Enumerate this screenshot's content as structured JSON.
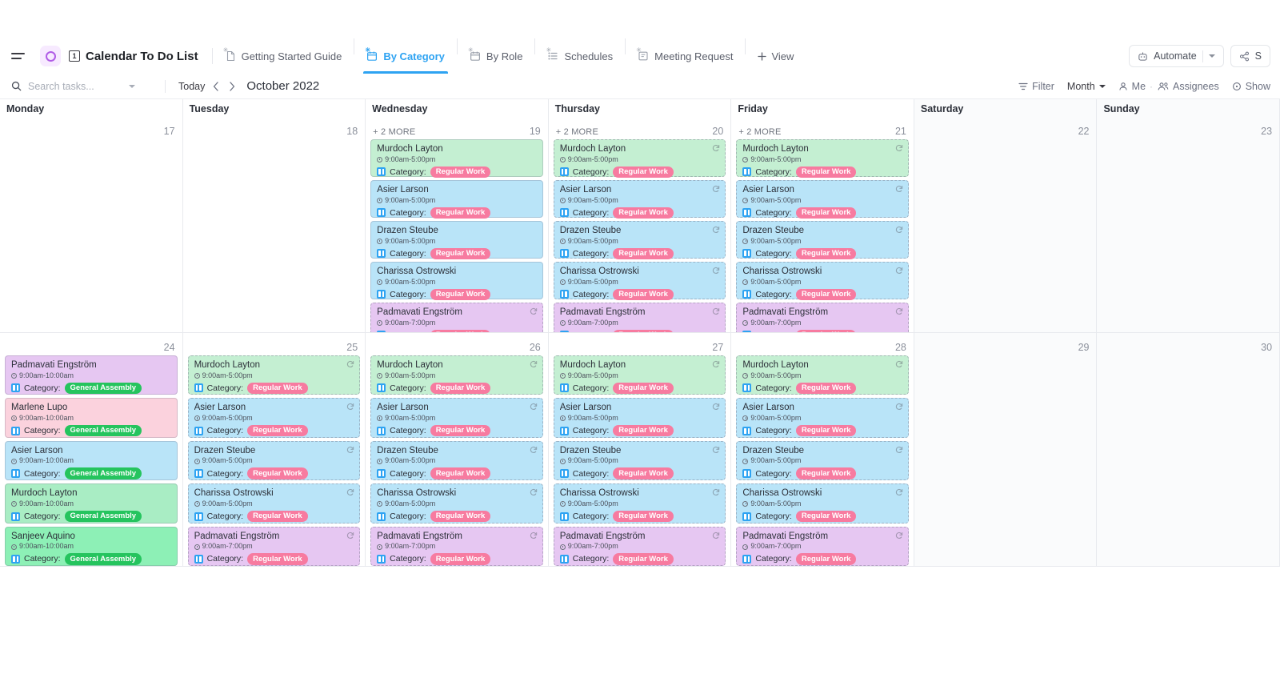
{
  "app": {
    "workspace_icon": "circle-ring-icon",
    "doc_icon_label": "1",
    "title": "Calendar To Do List",
    "menu_icon": "hamburger-menu-icon"
  },
  "view_tabs": [
    {
      "label": "Getting Started Guide",
      "icon": "doc-icon",
      "active": false
    },
    {
      "label": "By Category",
      "icon": "calendar-icon",
      "active": true
    },
    {
      "label": "By Role",
      "icon": "calendar-icon",
      "active": false
    },
    {
      "label": "Schedules",
      "icon": "list-icon",
      "active": false
    },
    {
      "label": "Meeting Request",
      "icon": "form-icon",
      "active": false
    }
  ],
  "add_view": {
    "label": "View",
    "icon": "plus-icon"
  },
  "topbar_right": {
    "automate": {
      "label": "Automate",
      "icon": "robot-icon",
      "caret": "chevron-down-icon"
    },
    "share": {
      "label": "S",
      "icon": "share-icon"
    }
  },
  "toolbar": {
    "search": {
      "placeholder": "Search tasks...",
      "value": "",
      "icon": "search-icon",
      "caret": "chevron-down-icon"
    },
    "today_label": "Today",
    "prev_icon": "chevron-left-icon",
    "next_icon": "chevron-right-icon",
    "month_label": "October 2022",
    "filter": {
      "label": "Filter",
      "icon": "filter-icon"
    },
    "zoom_level": {
      "label": "Month",
      "caret": "chevron-down-icon"
    },
    "me": {
      "label": "Me",
      "icon": "user-icon"
    },
    "dot": "·",
    "assignees": {
      "label": "Assignees",
      "icon": "users-icon"
    },
    "show": {
      "label": "Show",
      "icon": "eye-icon"
    }
  },
  "colors": {
    "accent": "#2ea3f2",
    "tag_regular_work": "#f77ba0",
    "tag_general_assembly": "#25c45e",
    "card_green": "#c4efd2",
    "card_blue": "#b9e4f8",
    "card_purple": "#e6c7f2",
    "card_pink": "#fbd2dd",
    "card_mint": "#8df0b6",
    "weekend_bg": "#fafbfc"
  },
  "calendar": {
    "day_names": [
      "Monday",
      "Tuesday",
      "Wednesday",
      "Thursday",
      "Friday",
      "Saturday",
      "Sunday"
    ],
    "weeks": [
      {
        "days": [
          {
            "name": "Monday",
            "num": "17",
            "weekend": false,
            "more": "",
            "events": []
          },
          {
            "name": "Tuesday",
            "num": "18",
            "weekend": false,
            "more": "",
            "events": []
          },
          {
            "name": "Wednesday",
            "num": "19",
            "weekend": false,
            "more": "+ 2 MORE",
            "events": [
              {
                "title": "Murdoch Layton",
                "time": "9:00am-5:00pm",
                "cat_label": "Category:",
                "tag": "Regular Work",
                "color": "#c4efd2",
                "tag_color": "#f77ba0",
                "border": "solid",
                "recur": false
              },
              {
                "title": "Asier Larson",
                "time": "9:00am-5:00pm",
                "cat_label": "Category:",
                "tag": "Regular Work",
                "color": "#b9e4f8",
                "tag_color": "#f77ba0",
                "border": "solid",
                "recur": false
              },
              {
                "title": "Drazen Steube",
                "time": "9:00am-5:00pm",
                "cat_label": "Category:",
                "tag": "Regular Work",
                "color": "#b9e4f8",
                "tag_color": "#f77ba0",
                "border": "solid",
                "recur": false
              },
              {
                "title": "Charissa Ostrowski",
                "time": "9:00am-5:00pm",
                "cat_label": "Category:",
                "tag": "Regular Work",
                "color": "#b9e4f8",
                "tag_color": "#f77ba0",
                "border": "solid",
                "recur": false
              },
              {
                "title": "Padmavati Engström",
                "time": "9:00am-7:00pm",
                "cat_label": "Category:",
                "tag": "Regular Work",
                "color": "#e6c7f2",
                "tag_color": "#f77ba0",
                "border": "dashed",
                "recur": true
              }
            ]
          },
          {
            "name": "Thursday",
            "num": "20",
            "weekend": false,
            "more": "+ 2 MORE",
            "events": [
              {
                "title": "Murdoch Layton",
                "time": "9:00am-5:00pm",
                "cat_label": "Category:",
                "tag": "Regular Work",
                "color": "#c4efd2",
                "tag_color": "#f77ba0",
                "border": "dashed",
                "recur": true
              },
              {
                "title": "Asier Larson",
                "time": "9:00am-5:00pm",
                "cat_label": "Category:",
                "tag": "Regular Work",
                "color": "#b9e4f8",
                "tag_color": "#f77ba0",
                "border": "dashed",
                "recur": true
              },
              {
                "title": "Drazen Steube",
                "time": "9:00am-5:00pm",
                "cat_label": "Category:",
                "tag": "Regular Work",
                "color": "#b9e4f8",
                "tag_color": "#f77ba0",
                "border": "dashed",
                "recur": true
              },
              {
                "title": "Charissa Ostrowski",
                "time": "9:00am-5:00pm",
                "cat_label": "Category:",
                "tag": "Regular Work",
                "color": "#b9e4f8",
                "tag_color": "#f77ba0",
                "border": "dashed",
                "recur": true
              },
              {
                "title": "Padmavati Engström",
                "time": "9:00am-7:00pm",
                "cat_label": "Category:",
                "tag": "Regular Work",
                "color": "#e6c7f2",
                "tag_color": "#f77ba0",
                "border": "dashed",
                "recur": true
              }
            ]
          },
          {
            "name": "Friday",
            "num": "21",
            "weekend": false,
            "more": "+ 2 MORE",
            "events": [
              {
                "title": "Murdoch Layton",
                "time": "9:00am-5:00pm",
                "cat_label": "Category:",
                "tag": "Regular Work",
                "color": "#c4efd2",
                "tag_color": "#f77ba0",
                "border": "dashed",
                "recur": true
              },
              {
                "title": "Asier Larson",
                "time": "9:00am-5:00pm",
                "cat_label": "Category:",
                "tag": "Regular Work",
                "color": "#b9e4f8",
                "tag_color": "#f77ba0",
                "border": "dashed",
                "recur": true
              },
              {
                "title": "Drazen Steube",
                "time": "9:00am-5:00pm",
                "cat_label": "Category:",
                "tag": "Regular Work",
                "color": "#b9e4f8",
                "tag_color": "#f77ba0",
                "border": "dashed",
                "recur": true
              },
              {
                "title": "Charissa Ostrowski",
                "time": "9:00am-5:00pm",
                "cat_label": "Category:",
                "tag": "Regular Work",
                "color": "#b9e4f8",
                "tag_color": "#f77ba0",
                "border": "dashed",
                "recur": true
              },
              {
                "title": "Padmavati Engström",
                "time": "9:00am-7:00pm",
                "cat_label": "Category:",
                "tag": "Regular Work",
                "color": "#e6c7f2",
                "tag_color": "#f77ba0",
                "border": "dashed",
                "recur": true
              }
            ]
          },
          {
            "name": "Saturday",
            "num": "22",
            "weekend": true,
            "more": "",
            "events": []
          },
          {
            "name": "Sunday",
            "num": "23",
            "weekend": true,
            "more": "",
            "events": []
          }
        ]
      },
      {
        "days": [
          {
            "name": "",
            "num": "24",
            "weekend": false,
            "more": "",
            "events": [
              {
                "title": "Padmavati Engström",
                "time": "9:00am-10:00am",
                "cat_label": "Category:",
                "tag": "General Assembly",
                "color": "#e6c7f2",
                "tag_color": "#25c45e",
                "border": "solid",
                "recur": false
              },
              {
                "title": "Marlene Lupo",
                "time": "9:00am-10:00am",
                "cat_label": "Category:",
                "tag": "General Assembly",
                "color": "#fbd2dd",
                "tag_color": "#25c45e",
                "border": "solid",
                "recur": false
              },
              {
                "title": "Asier Larson",
                "time": "9:00am-10:00am",
                "cat_label": "Category:",
                "tag": "General Assembly",
                "color": "#b9e4f8",
                "tag_color": "#25c45e",
                "border": "solid",
                "recur": false
              },
              {
                "title": "Murdoch Layton",
                "time": "9:00am-10:00am",
                "cat_label": "Category:",
                "tag": "General Assembly",
                "color": "#a9edc4",
                "tag_color": "#25c45e",
                "border": "solid",
                "recur": false
              },
              {
                "title": "Sanjeev Aquino",
                "time": "9:00am-10:00am",
                "cat_label": "Category:",
                "tag": "General Assembly",
                "color": "#8df0b6",
                "tag_color": "#25c45e",
                "border": "solid",
                "recur": false
              }
            ]
          },
          {
            "name": "",
            "num": "25",
            "weekend": false,
            "more": "",
            "events": [
              {
                "title": "Murdoch Layton",
                "time": "9:00am-5:00pm",
                "cat_label": "Category:",
                "tag": "Regular Work",
                "color": "#c4efd2",
                "tag_color": "#f77ba0",
                "border": "dashed",
                "recur": true
              },
              {
                "title": "Asier Larson",
                "time": "9:00am-5:00pm",
                "cat_label": "Category:",
                "tag": "Regular Work",
                "color": "#b9e4f8",
                "tag_color": "#f77ba0",
                "border": "dashed",
                "recur": true
              },
              {
                "title": "Drazen Steube",
                "time": "9:00am-5:00pm",
                "cat_label": "Category:",
                "tag": "Regular Work",
                "color": "#b9e4f8",
                "tag_color": "#f77ba0",
                "border": "dashed",
                "recur": true
              },
              {
                "title": "Charissa Ostrowski",
                "time": "9:00am-5:00pm",
                "cat_label": "Category:",
                "tag": "Regular Work",
                "color": "#b9e4f8",
                "tag_color": "#f77ba0",
                "border": "dashed",
                "recur": true
              },
              {
                "title": "Padmavati Engström",
                "time": "9:00am-7:00pm",
                "cat_label": "Category:",
                "tag": "Regular Work",
                "color": "#e6c7f2",
                "tag_color": "#f77ba0",
                "border": "dashed",
                "recur": true
              }
            ]
          },
          {
            "name": "",
            "num": "26",
            "weekend": false,
            "more": "",
            "events": [
              {
                "title": "Murdoch Layton",
                "time": "9:00am-5:00pm",
                "cat_label": "Category:",
                "tag": "Regular Work",
                "color": "#c4efd2",
                "tag_color": "#f77ba0",
                "border": "dashed",
                "recur": true
              },
              {
                "title": "Asier Larson",
                "time": "9:00am-5:00pm",
                "cat_label": "Category:",
                "tag": "Regular Work",
                "color": "#b9e4f8",
                "tag_color": "#f77ba0",
                "border": "dashed",
                "recur": true
              },
              {
                "title": "Drazen Steube",
                "time": "9:00am-5:00pm",
                "cat_label": "Category:",
                "tag": "Regular Work",
                "color": "#b9e4f8",
                "tag_color": "#f77ba0",
                "border": "dashed",
                "recur": true
              },
              {
                "title": "Charissa Ostrowski",
                "time": "9:00am-5:00pm",
                "cat_label": "Category:",
                "tag": "Regular Work",
                "color": "#b9e4f8",
                "tag_color": "#f77ba0",
                "border": "dashed",
                "recur": true
              },
              {
                "title": "Padmavati Engström",
                "time": "9:00am-7:00pm",
                "cat_label": "Category:",
                "tag": "Regular Work",
                "color": "#e6c7f2",
                "tag_color": "#f77ba0",
                "border": "dashed",
                "recur": true
              }
            ]
          },
          {
            "name": "",
            "num": "27",
            "weekend": false,
            "more": "",
            "events": [
              {
                "title": "Murdoch Layton",
                "time": "9:00am-5:00pm",
                "cat_label": "Category:",
                "tag": "Regular Work",
                "color": "#c4efd2",
                "tag_color": "#f77ba0",
                "border": "dashed",
                "recur": true
              },
              {
                "title": "Asier Larson",
                "time": "9:00am-5:00pm",
                "cat_label": "Category:",
                "tag": "Regular Work",
                "color": "#b9e4f8",
                "tag_color": "#f77ba0",
                "border": "dashed",
                "recur": true
              },
              {
                "title": "Drazen Steube",
                "time": "9:00am-5:00pm",
                "cat_label": "Category:",
                "tag": "Regular Work",
                "color": "#b9e4f8",
                "tag_color": "#f77ba0",
                "border": "dashed",
                "recur": true
              },
              {
                "title": "Charissa Ostrowski",
                "time": "9:00am-5:00pm",
                "cat_label": "Category:",
                "tag": "Regular Work",
                "color": "#b9e4f8",
                "tag_color": "#f77ba0",
                "border": "dashed",
                "recur": true
              },
              {
                "title": "Padmavati Engström",
                "time": "9:00am-7:00pm",
                "cat_label": "Category:",
                "tag": "Regular Work",
                "color": "#e6c7f2",
                "tag_color": "#f77ba0",
                "border": "dashed",
                "recur": true
              }
            ]
          },
          {
            "name": "",
            "num": "28",
            "weekend": false,
            "more": "",
            "events": [
              {
                "title": "Murdoch Layton",
                "time": "9:00am-5:00pm",
                "cat_label": "Category:",
                "tag": "Regular Work",
                "color": "#c4efd2",
                "tag_color": "#f77ba0",
                "border": "dashed",
                "recur": true
              },
              {
                "title": "Asier Larson",
                "time": "9:00am-5:00pm",
                "cat_label": "Category:",
                "tag": "Regular Work",
                "color": "#b9e4f8",
                "tag_color": "#f77ba0",
                "border": "dashed",
                "recur": true
              },
              {
                "title": "Drazen Steube",
                "time": "9:00am-5:00pm",
                "cat_label": "Category:",
                "tag": "Regular Work",
                "color": "#b9e4f8",
                "tag_color": "#f77ba0",
                "border": "dashed",
                "recur": true
              },
              {
                "title": "Charissa Ostrowski",
                "time": "9:00am-5:00pm",
                "cat_label": "Category:",
                "tag": "Regular Work",
                "color": "#b9e4f8",
                "tag_color": "#f77ba0",
                "border": "dashed",
                "recur": true
              },
              {
                "title": "Padmavati Engström",
                "time": "9:00am-7:00pm",
                "cat_label": "Category:",
                "tag": "Regular Work",
                "color": "#e6c7f2",
                "tag_color": "#f77ba0",
                "border": "dashed",
                "recur": true
              }
            ]
          },
          {
            "name": "",
            "num": "29",
            "weekend": true,
            "more": "",
            "events": []
          },
          {
            "name": "",
            "num": "30",
            "weekend": true,
            "more": "",
            "events": []
          }
        ]
      }
    ]
  }
}
